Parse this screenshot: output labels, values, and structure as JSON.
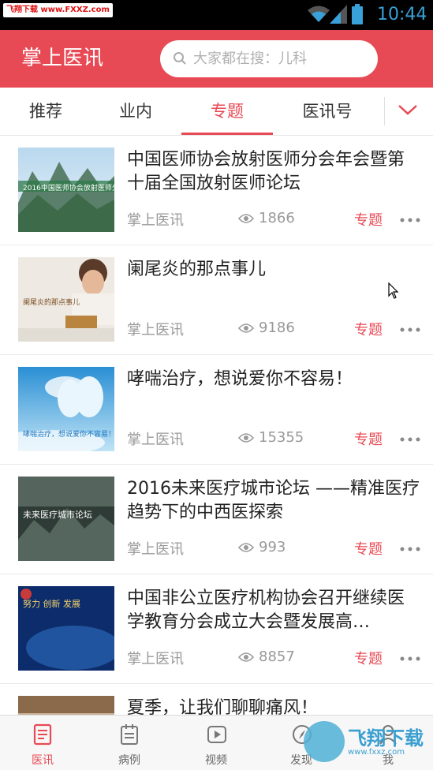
{
  "status_bar": {
    "time": "10:44",
    "watermark": "飞翔下载 www.FXXZ.com"
  },
  "header": {
    "title": "掌上医讯",
    "search_placeholder": "大家都在搜：儿科"
  },
  "tabs": [
    {
      "label": "推荐"
    },
    {
      "label": "业内"
    },
    {
      "label": "专题"
    },
    {
      "label": "医讯号"
    }
  ],
  "active_tab": "专题",
  "articles": [
    {
      "title": "中国医师协会放射医师分会年会暨第十届全国放射医师论坛",
      "source": "掌上医讯",
      "views": "1866",
      "tag": "专题",
      "thumb_caption": "2016中国医师协会放射医师分会年会"
    },
    {
      "title": "阑尾炎的那点事儿",
      "source": "掌上医讯",
      "views": "9186",
      "tag": "专题",
      "thumb_caption": "阑尾炎的那点事儿"
    },
    {
      "title": "哮喘治疗，想说爱你不容易！",
      "source": "掌上医讯",
      "views": "15355",
      "tag": "专题",
      "thumb_caption": "哮喘治疗，想说爱你不容易！"
    },
    {
      "title": "2016未来医疗城市论坛 ——精准医疗趋势下的中西医探索",
      "source": "掌上医讯",
      "views": "993",
      "tag": "专题",
      "thumb_caption": "未来医疗城市论坛"
    },
    {
      "title": "中国非公立医疗机构协会召开继续医学教育分会成立大会暨发展高…",
      "source": "掌上医讯",
      "views": "8857",
      "tag": "专题",
      "thumb_caption": "努力 创新 发展"
    },
    {
      "title": "夏季，让我们聊聊痛风！",
      "source": "",
      "views": "",
      "tag": "",
      "thumb_caption": ""
    }
  ],
  "bottom_nav": [
    {
      "label": "医讯",
      "icon": "doc-list-icon"
    },
    {
      "label": "病例",
      "icon": "calendar-list-icon"
    },
    {
      "label": "视频",
      "icon": "play-icon"
    },
    {
      "label": "发现",
      "icon": "compass-icon"
    },
    {
      "label": "我",
      "icon": "person-icon"
    }
  ],
  "bottom_watermark": {
    "name": "飞翔下载",
    "url": "www.fxxz.com"
  },
  "colors": {
    "brand": "#e84a55",
    "status_icons": "#3aa0d8"
  }
}
